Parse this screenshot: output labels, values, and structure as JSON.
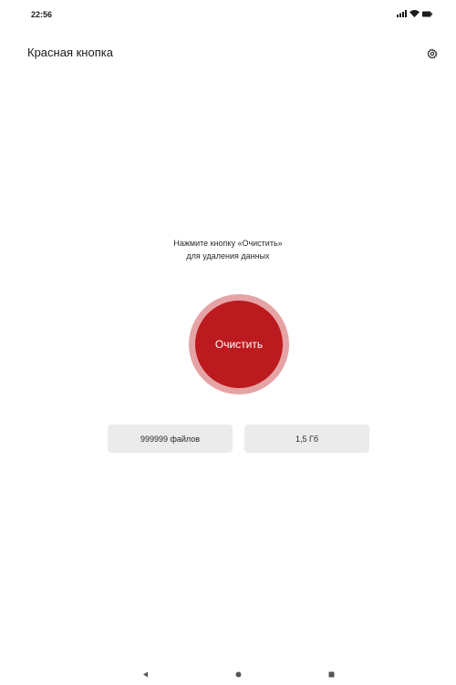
{
  "status_bar": {
    "time": "22:56",
    "icons": [
      "signal-icon",
      "wifi-icon",
      "battery-icon"
    ]
  },
  "app_bar": {
    "title": "Красная кнопка",
    "settings_icon": "gear-icon"
  },
  "main": {
    "instruction_line1": "Нажмите кнопку «Очистить»",
    "instruction_line2": "для удаления данных",
    "clear_button_label": "Очистить",
    "files_count": "999999 файлов",
    "size": "1,5 Гб"
  },
  "nav_bar": {
    "icons": [
      "back-icon",
      "home-icon",
      "recents-icon"
    ]
  },
  "colors": {
    "accent": "#bb1a1e",
    "accent_ring": "#e6a3a5",
    "chip_background": "#ebebeb"
  }
}
